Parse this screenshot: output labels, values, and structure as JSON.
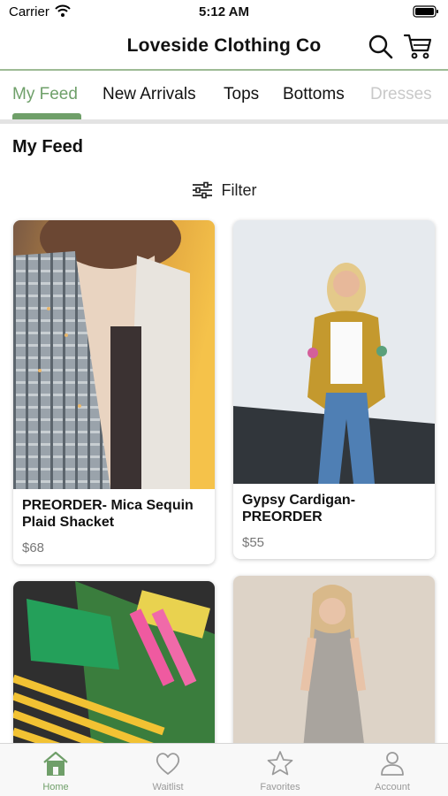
{
  "status_bar": {
    "carrier": "Carrier",
    "time": "5:12 AM"
  },
  "header": {
    "title": "Loveside Clothing Co"
  },
  "category_tabs": [
    {
      "label": "My Feed",
      "active": true
    },
    {
      "label": "New Arrivals",
      "active": false
    },
    {
      "label": "Tops",
      "active": false
    },
    {
      "label": "Bottoms",
      "active": false
    },
    {
      "label": "Dresses",
      "active": false
    }
  ],
  "feed": {
    "title": "My Feed",
    "filter_label": "Filter",
    "products": [
      {
        "name": "PREORDER- Mica Sequin Plaid Shacket",
        "price": "$68"
      },
      {
        "name": "Gypsy Cardigan- PREORDER",
        "price": "$55"
      },
      {
        "name": "",
        "price": ""
      },
      {
        "name": "",
        "price": ""
      }
    ]
  },
  "bottom_tabs": [
    {
      "label": "Home",
      "icon": "home-icon",
      "active": true
    },
    {
      "label": "Waitlist",
      "icon": "heart-icon",
      "active": false
    },
    {
      "label": "Favorites",
      "icon": "star-icon",
      "active": false
    },
    {
      "label": "Account",
      "icon": "person-icon",
      "active": false
    }
  ],
  "colors": {
    "accent": "#6f9f69",
    "header_rule": "#9dbb95",
    "inactive": "#999999"
  }
}
